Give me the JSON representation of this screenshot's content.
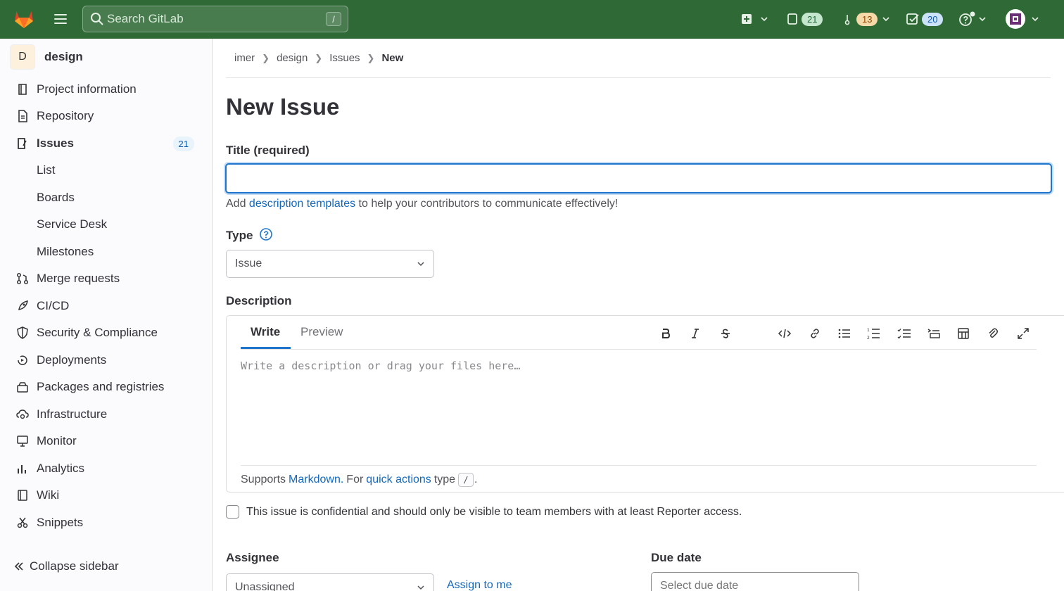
{
  "topbar": {
    "search_placeholder": "Search GitLab",
    "search_shortcut": "/",
    "issues_count": "21",
    "merge_requests_count": "13",
    "todos_count": "20"
  },
  "sidebar": {
    "project_initial": "D",
    "project_name": "design",
    "items": [
      {
        "label": "Project information",
        "icon": "project-info-icon"
      },
      {
        "label": "Repository",
        "icon": "repository-icon"
      },
      {
        "label": "Issues",
        "icon": "issues-icon",
        "count": "21"
      },
      {
        "label": "List"
      },
      {
        "label": "Boards"
      },
      {
        "label": "Service Desk"
      },
      {
        "label": "Milestones"
      },
      {
        "label": "Merge requests",
        "icon": "merge-request-icon"
      },
      {
        "label": "CI/CD",
        "icon": "rocket-icon"
      },
      {
        "label": "Security & Compliance",
        "icon": "shield-icon"
      },
      {
        "label": "Deployments",
        "icon": "deployments-icon"
      },
      {
        "label": "Packages and registries",
        "icon": "package-icon"
      },
      {
        "label": "Infrastructure",
        "icon": "cloud-gear-icon"
      },
      {
        "label": "Monitor",
        "icon": "monitor-icon"
      },
      {
        "label": "Analytics",
        "icon": "chart-icon"
      },
      {
        "label": "Wiki",
        "icon": "book-icon"
      },
      {
        "label": "Snippets",
        "icon": "snippet-icon"
      }
    ],
    "collapse_label": "Collapse sidebar"
  },
  "breadcrumb": {
    "items": [
      "imer",
      "design",
      "Issues"
    ],
    "current": "New"
  },
  "form": {
    "page_title": "New Issue",
    "title_label": "Title (required)",
    "title_value": "",
    "helper_prefix": "Add ",
    "helper_link": "description templates",
    "helper_suffix": " to help your contributors to communicate effectively!",
    "type_label": "Type",
    "type_value": "Issue",
    "description_label": "Description",
    "tab_write": "Write",
    "tab_preview": "Preview",
    "description_placeholder": "Write a description or drag your files here…",
    "supports_prefix": "Supports",
    "markdown_link": "Markdown.",
    "quick_actions_link": "quick actions",
    "type_word": "type",
    "slash_key": "/",
    "end_dot": ".",
    "confidential_label": "This issue is confidential and should only be visible to team members with at least Reporter access.",
    "assignee_label": "Assignee",
    "assignee_value": "Unassigned",
    "assign_to_me": "Assign to me",
    "due_date_label": "Due date",
    "due_date_placeholder": "Select due date"
  },
  "colors": {
    "topbar": "#2f6a36",
    "link": "#1068bf",
    "focus": "#1f75cb"
  }
}
